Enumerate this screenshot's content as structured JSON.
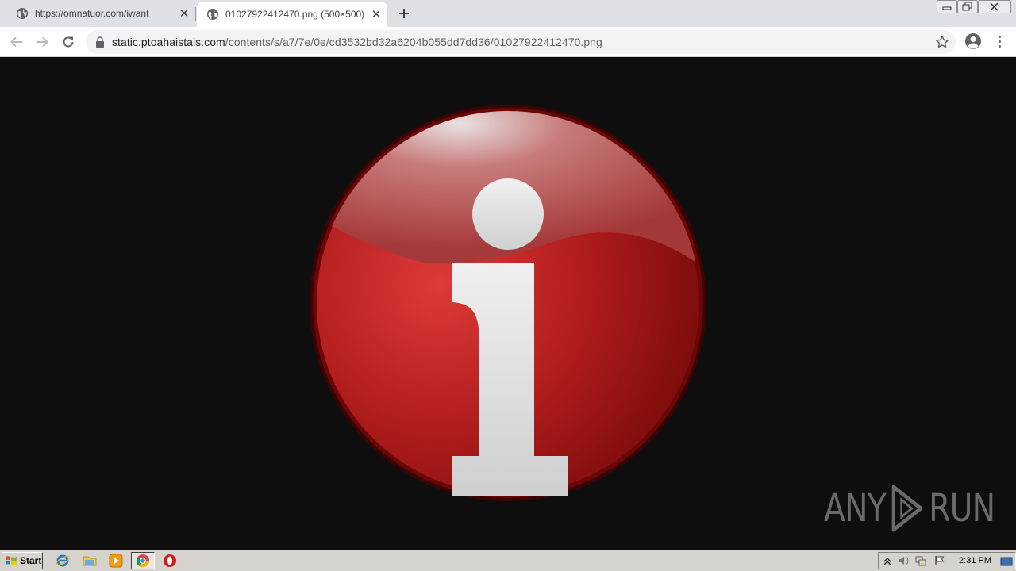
{
  "browser": {
    "tabs": [
      {
        "title": "https://omnatuor.com/iwant",
        "favicon": "globe-icon",
        "active": false
      },
      {
        "title": "01027922412470.png (500×500)",
        "favicon": "globe-icon",
        "active": true
      }
    ],
    "address": {
      "host": "static.ptoahaistais.com",
      "path": "/contents/s/a7/7e/0e/cd3532bd32a6204b055dd7dd36/01027922412470.png"
    }
  },
  "content": {
    "image_icon": "red-info-icon",
    "watermark": {
      "left": "ANY",
      "right": "RUN"
    }
  },
  "taskbar": {
    "start_label": "Start",
    "pinned": [
      "internet-explorer-icon",
      "folder-icon",
      "media-player-icon",
      "chrome-icon",
      "opera-icon"
    ],
    "clock": "2:31 PM"
  },
  "colors": {
    "tabstrip": "#dee1e6",
    "icon_red": "#a51a1a",
    "page_bg": "#0e0e0e",
    "taskbar": "#d6d3ce"
  }
}
